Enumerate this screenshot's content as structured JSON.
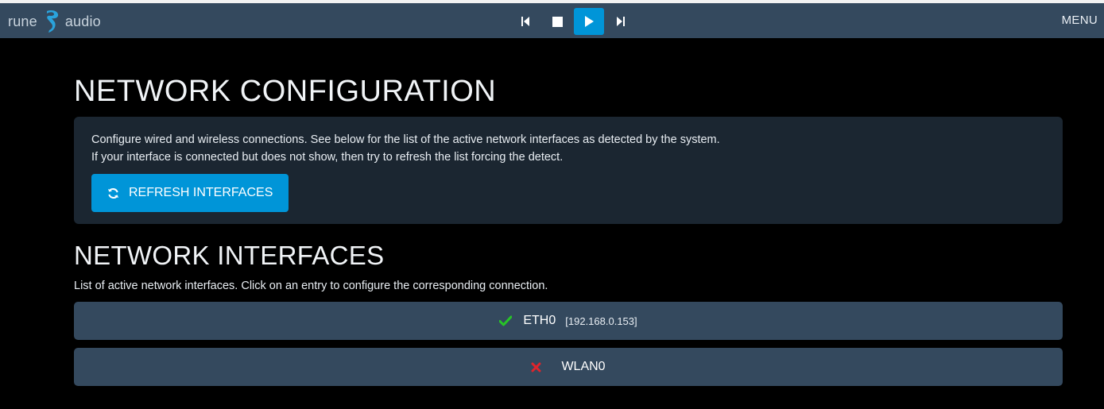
{
  "brand": {
    "word_left": "rune",
    "word_right": "audio",
    "logo_icon": "rune-logo-icon"
  },
  "player_controls": [
    {
      "name": "previous",
      "icon": "skip-previous-icon"
    },
    {
      "name": "stop",
      "icon": "stop-icon"
    },
    {
      "name": "play",
      "icon": "play-icon",
      "active": true
    },
    {
      "name": "next",
      "icon": "skip-next-icon"
    }
  ],
  "menu_label": "MENU",
  "page_title": "NETWORK CONFIGURATION",
  "info_panel": {
    "line1": "Configure wired and wireless connections. See below for the list of the active network interfaces as detected by the system.",
    "line2": "If your interface is connected but does not show, then try to refresh the list forcing the detect.",
    "refresh_label": "REFRESH INTERFACES",
    "refresh_icon": "refresh-icon"
  },
  "interfaces_section": {
    "title": "NETWORK INTERFACES",
    "description": "List of active network interfaces. Click on an entry to configure the corresponding connection.",
    "items": [
      {
        "name": "ETH0",
        "ip": "[192.168.0.153]",
        "status": "connected",
        "status_icon": "check-icon"
      },
      {
        "name": "WLAN0",
        "ip": "",
        "status": "disconnected",
        "status_icon": "cross-icon"
      }
    ]
  },
  "colors": {
    "navbar": "#34495e",
    "accent": "#0095d8",
    "panel": "#1b2631",
    "ok": "#27c427",
    "error": "#e0242b"
  }
}
